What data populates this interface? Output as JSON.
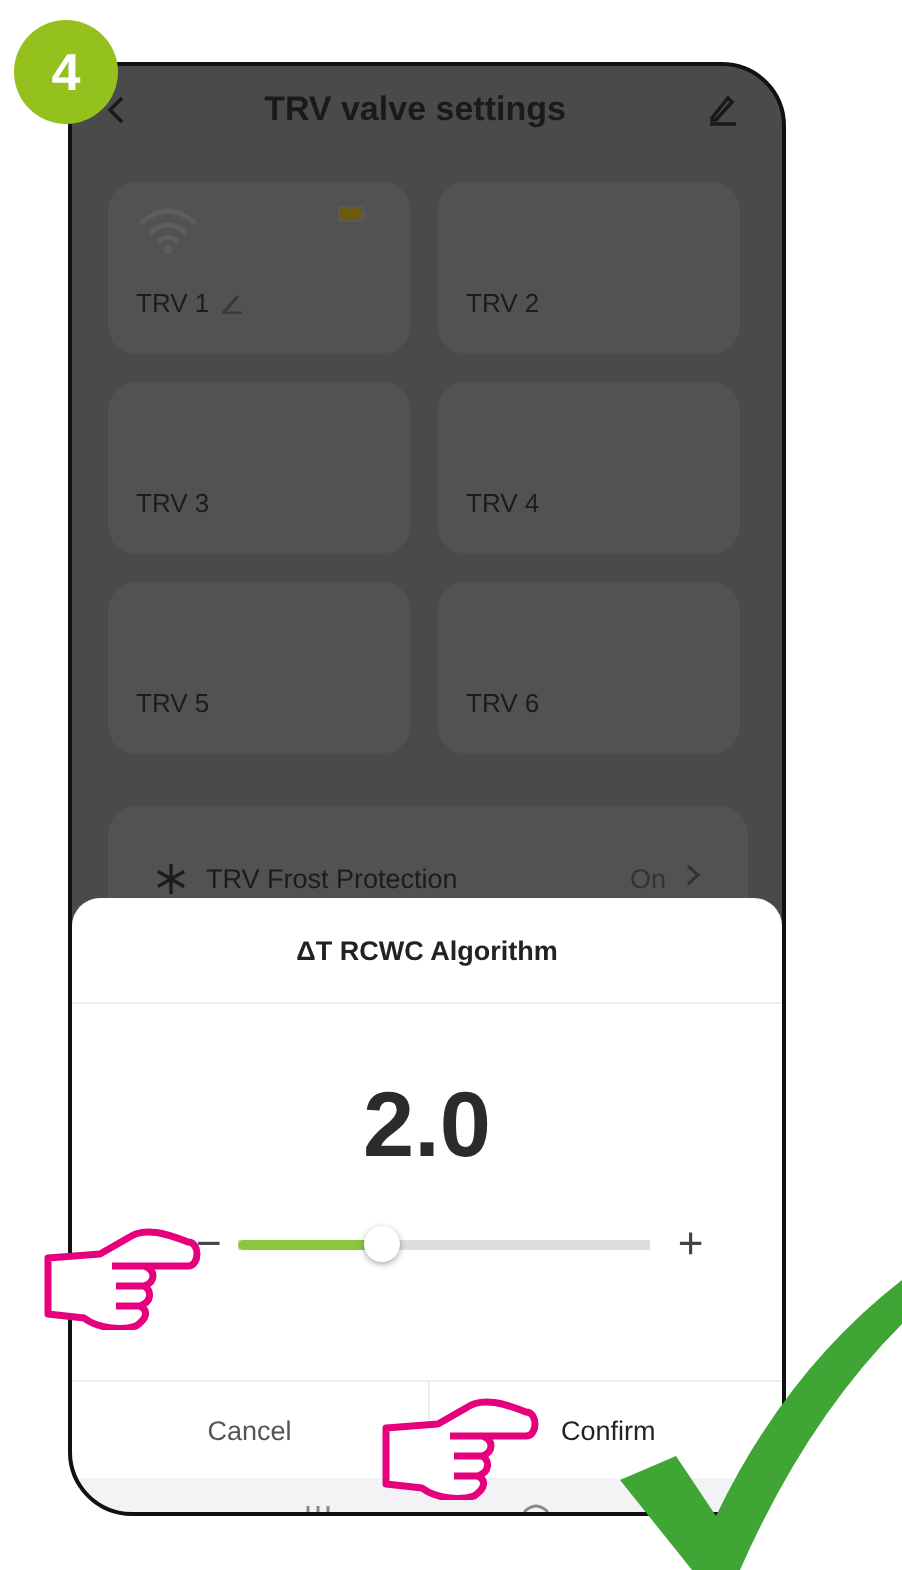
{
  "step_badge": "4",
  "header": {
    "title": "TRV valve settings"
  },
  "devices": [
    {
      "name": "TRV 1",
      "online": true
    },
    {
      "name": "TRV 2",
      "online": false
    },
    {
      "name": "TRV 3",
      "online": false
    },
    {
      "name": "TRV 4",
      "online": false
    },
    {
      "name": "TRV 5",
      "online": false
    },
    {
      "name": "TRV 6",
      "online": false
    }
  ],
  "frost_protection": {
    "label": "TRV Frost Protection",
    "value": "On"
  },
  "dialog": {
    "title": "ΔT RCWC Algorithm",
    "value": "2.0",
    "slider": {
      "minus": "−",
      "plus": "+",
      "level": 0.35
    },
    "cancel": "Cancel",
    "confirm": "Confirm"
  }
}
